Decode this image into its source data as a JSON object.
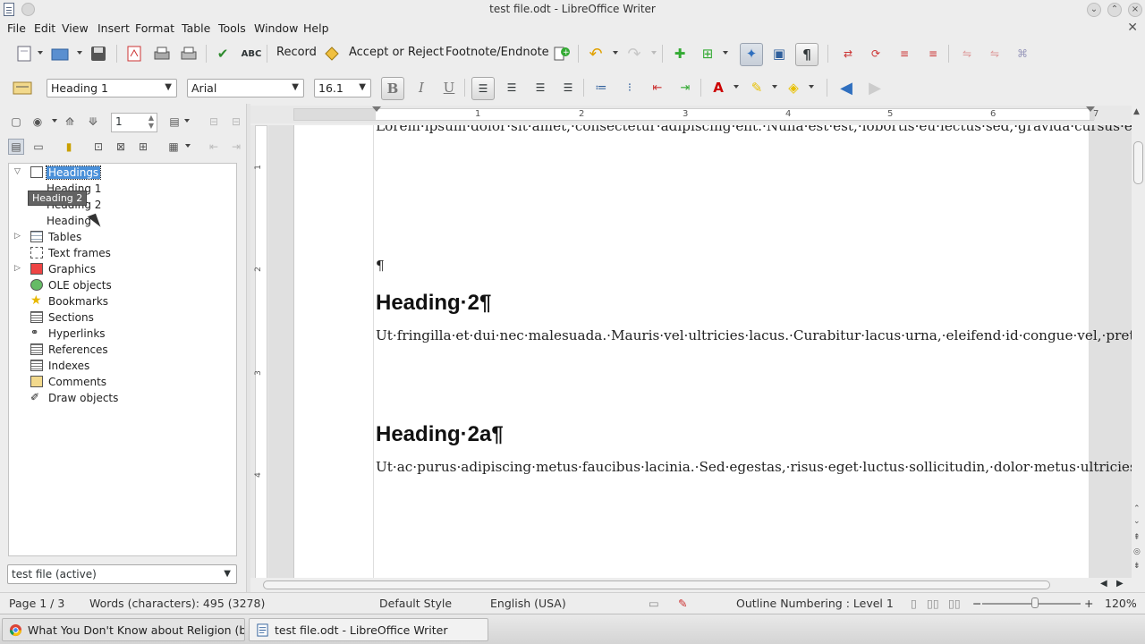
{
  "window": {
    "title": "test file.odt - LibreOffice Writer"
  },
  "menu": {
    "items": [
      "File",
      "Edit",
      "View",
      "Insert",
      "Format",
      "Table",
      "Tools",
      "Window",
      "Help"
    ]
  },
  "toolbar": {
    "record": "Record",
    "accept_reject": "Accept or Reject",
    "footnote_endnote": "Footnote/Endnote"
  },
  "formatting": {
    "paragraph_style": "Heading 1",
    "font_name": "Arial",
    "font_size": "16.1"
  },
  "navigator": {
    "page_number": "1",
    "tooltip": "Heading 2",
    "tree": [
      {
        "label": "Headings",
        "selected": true,
        "expanded": true,
        "icon": "headings-icon"
      },
      {
        "label": "Heading 1",
        "child": true
      },
      {
        "label": "Heading 2",
        "child": true
      },
      {
        "label": "Heading",
        "child": true
      },
      {
        "label": "Tables",
        "expandable": true,
        "icon": "table-icon"
      },
      {
        "label": "Text frames",
        "icon": "frame-icon"
      },
      {
        "label": "Graphics",
        "expandable": true,
        "icon": "graphics-icon"
      },
      {
        "label": "OLE objects",
        "icon": "ole-icon"
      },
      {
        "label": "Bookmarks",
        "icon": "bookmark-icon"
      },
      {
        "label": "Sections",
        "icon": "section-icon"
      },
      {
        "label": "Hyperlinks",
        "icon": "hyperlink-icon"
      },
      {
        "label": "References",
        "icon": "reference-icon"
      },
      {
        "label": "Indexes",
        "icon": "index-icon"
      },
      {
        "label": "Comments",
        "icon": "comment-icon"
      },
      {
        "label": "Draw objects",
        "icon": "draw-icon"
      }
    ],
    "document_select": "test file (active)"
  },
  "ruler": {
    "top_numbers": [
      "1",
      "2",
      "3",
      "4",
      "5",
      "6",
      "7"
    ],
    "left_numbers": [
      "1",
      "2",
      "3",
      "4"
    ]
  },
  "document": {
    "para1": "Lorem·ipsum·dolor·sit·amet,·consectetur·adipiscing·elit.·Nulla·est·est,·lobortis·eu·lectus·sed,·gravida·cursus·enim.·Donec·dictum·id·dolor·in·molestie.·Donec·elementum·odio·dignissim·ante·congue,·eget·molestie·arcu·euismod.·Ut·rhoncus·faucibus·ipsum·eu·malesuada.·Pellentesque·tincidunt·placerat·varius.·Ut·facilisis·adipiscing·sem,·a·laoreet·lorem·consectetur·eget.·Aliquam·iaculis,·lacus·commodo·dapibus·fringilla,·est·augue·blandit·diam,·eu·porttitor·mauris·tellus·eu·neque.·Curabitur·eleifend·turpis·orci,·sed·scelerisque·dolor·suscipit·et.·Cras·et·sollicitudin·nunc.·Pellentesque·venenatis·rhoncus·sapien·ac·viverra.·In·volutpat·sapien·ut·turpis·pulvinar·porta.¶",
    "empty_para": "¶",
    "heading2": "Heading·2¶",
    "para2": "Ut·fringilla·et·dui·nec·malesuada.·Mauris·vel·ultricies·lacus.·Curabitur·lacus·urna,·eleifend·id·congue·vel,·pretium·vitae·diam.·Phasellus·iaculis,·dolor·eget·interdum·eleifend,·lectus·orci·scelerisque·felis,·eu·lacinia·erat·mauris·id·arcu.·Maecenas·eu·lorem·quis·nunc·facilisis·tincidunt.·Maecenas·ac·convallis·risus.·Sed·vel·tempor·enim,·sit·amet·tristique·mi.·Maecenas·congue·consectetur·mattis.¶",
    "heading2a": "Heading·2a¶",
    "para3": "Ut·ac·purus·adipiscing·metus·faucibus·lacinia.·Sed·egestas,·risus·eget·luctus·sollicitudin,·dolor·metus·ultricies·tortor,·eu·sollicitudin·metus·elit·vitae·sem.·Sed·facilisis·suscipit·augue,·non·fermentum·mauris·molestie·eu.·Donec·metus·nulla,·dictum·in·tempus·sed,·sagittis·sit·amet·nisl.·Quisque·tempor·est·et·velit·pharetra·porttitor.·Sed·volutpat·rhoncus·eros·id·bibendum.·Nulla·tempor·eros·id·blandit·euismod.·Etiam·ornare,·eros·pharetra·molestie·congue,·velit·turpis·cursus·nisl,·nec·suscipit·purus·nibh·nec·erat.·Duis·mattis·pellentesque·viverra.·Ut·metus·velit,·faucibus·sed·libero·et,·vehicula·dictum·metus.·Maecenas·"
  },
  "status": {
    "page": "Page 1 / 3",
    "words": "Words (characters): 495 (3278)",
    "page_style": "Default Style",
    "language": "English (USA)",
    "outline": "Outline Numbering : Level 1",
    "zoom_minus": "−",
    "zoom_plus": "+",
    "zoom": "120%"
  },
  "taskbar": {
    "tasks": [
      {
        "label": "What You Don't Know about Religion (but Sh",
        "icon": "chrome-icon"
      },
      {
        "label": "test file.odt - LibreOffice Writer",
        "icon": "writer-icon",
        "active": true
      }
    ]
  },
  "colors": {
    "selection": "#4a90d9",
    "page_bg": "#ffffff",
    "chrome_bg": "#ededed"
  }
}
